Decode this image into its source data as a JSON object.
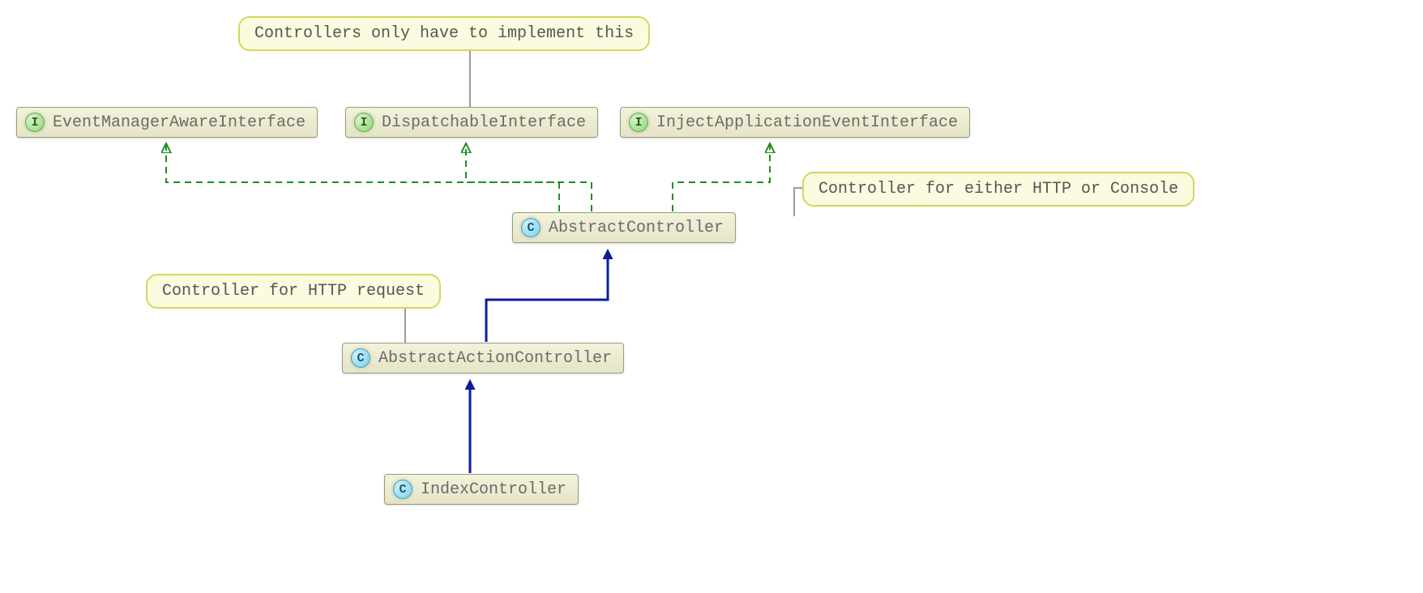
{
  "notes": {
    "implement": "Controllers only have to implement this",
    "httpOrConsole": "Controller for either HTTP or Console",
    "httpRequest": "Controller for HTTP request"
  },
  "nodes": {
    "eventManagerAware": {
      "type": "I",
      "label": "EventManagerAwareInterface"
    },
    "dispatchable": {
      "type": "I",
      "label": "DispatchableInterface"
    },
    "injectAppEvent": {
      "type": "I",
      "label": "InjectApplicationEventInterface"
    },
    "abstractController": {
      "type": "C",
      "label": "AbstractController"
    },
    "abstractAction": {
      "type": "C",
      "label": "AbstractActionController"
    },
    "indexController": {
      "type": "C",
      "label": "IndexController"
    }
  },
  "connectors": {
    "implements": [
      {
        "from": "abstractController",
        "to": "eventManagerAware"
      },
      {
        "from": "abstractController",
        "to": "dispatchable"
      },
      {
        "from": "abstractController",
        "to": "injectAppEvent"
      }
    ],
    "extends": [
      {
        "from": "abstractAction",
        "to": "abstractController"
      },
      {
        "from": "indexController",
        "to": "abstractAction"
      }
    ],
    "noteLinks": [
      {
        "note": "implement",
        "target": "dispatchable"
      },
      {
        "note": "httpOrConsole",
        "target": "abstractController"
      },
      {
        "note": "httpRequest",
        "target": "abstractAction"
      }
    ]
  }
}
